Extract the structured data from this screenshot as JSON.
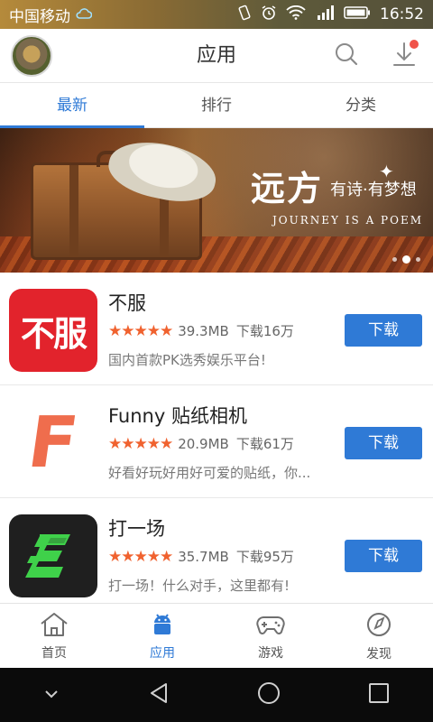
{
  "status_bar": {
    "carrier": "中国移动",
    "time": "16:52",
    "icons": [
      "cloud-icon",
      "vibrate-icon",
      "alarm-icon",
      "wifi-icon",
      "signal-icon",
      "battery-icon"
    ]
  },
  "header": {
    "title": "应用",
    "icons": {
      "search": "search-icon",
      "download": "download-icon"
    },
    "download_has_badge": true
  },
  "tabs": [
    {
      "label": "最新",
      "active": true
    },
    {
      "label": "排行",
      "active": false
    },
    {
      "label": "分类",
      "active": false
    }
  ],
  "banner": {
    "title": "远方",
    "subtitle": "有诗·有梦想",
    "english": "JOURNEY IS A POEM",
    "indicator_count": 3,
    "active_indicator": 2
  },
  "apps": [
    {
      "name": "不服",
      "icon_text": "不服",
      "rating": 5,
      "size": "39.3MB",
      "downloads": "下载16万",
      "description": "国内首款PK选秀娱乐平台!",
      "button": "下载"
    },
    {
      "name": "Funny 贴纸相机",
      "icon_text": "F",
      "rating": 5,
      "size": "20.9MB",
      "downloads": "下载61万",
      "description": "好看好玩好用好可爱的贴纸，你...",
      "button": "下载"
    },
    {
      "name": "打一场",
      "icon_text": "",
      "rating": 5,
      "size": "35.7MB",
      "downloads": "下载95万",
      "description": "打一场！什么对手，这里都有!",
      "button": "下载"
    }
  ],
  "stars_text": "★★★★★",
  "bottom_nav": [
    {
      "label": "首页",
      "icon": "home-icon",
      "active": false
    },
    {
      "label": "应用",
      "icon": "android-icon",
      "active": true
    },
    {
      "label": "游戏",
      "icon": "gamepad-icon",
      "active": false
    },
    {
      "label": "发现",
      "icon": "compass-icon",
      "active": false
    }
  ],
  "system_nav": [
    "chevron-down-icon",
    "back-icon",
    "home-circle-icon",
    "recents-icon"
  ],
  "colors": {
    "accent": "#2f7ad6",
    "star": "#f0622f",
    "badge": "#f05349",
    "bufu_icon_bg": "#e2232c"
  }
}
